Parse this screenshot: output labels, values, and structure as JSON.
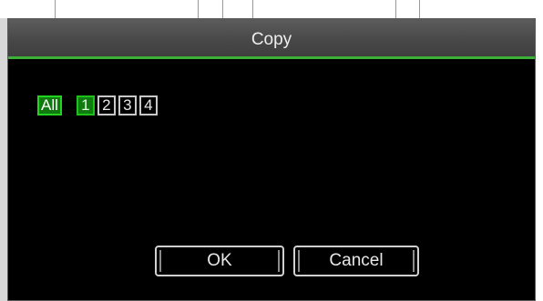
{
  "dialog": {
    "title": "Copy"
  },
  "channels": {
    "all_label": "All",
    "items": [
      {
        "label": "1",
        "selected": true
      },
      {
        "label": "2",
        "selected": false
      },
      {
        "label": "3",
        "selected": false
      },
      {
        "label": "4",
        "selected": false
      }
    ]
  },
  "buttons": {
    "ok_label": "OK",
    "cancel_label": "Cancel"
  },
  "colors": {
    "accent_green": "#3bb237",
    "titlebar": "#4a4a4a",
    "background": "#000000"
  }
}
